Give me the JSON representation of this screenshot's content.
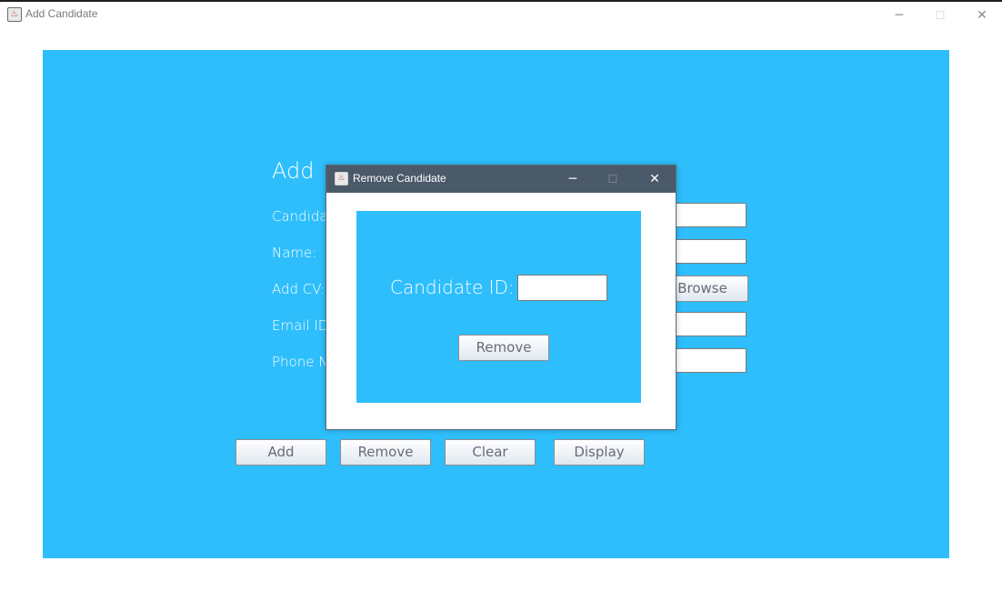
{
  "window": {
    "title": "Add Candidate",
    "controls": {
      "minimize": "─",
      "maximize": "☐",
      "close": "✕"
    }
  },
  "form": {
    "heading": "Add",
    "labels": [
      "Candida",
      "Name:",
      "Add CV:",
      "Email ID",
      "Phone N"
    ],
    "browse_button": "Browse",
    "buttons": {
      "add": "Add",
      "remove": "Remove",
      "clear": "Clear",
      "display": "Display"
    }
  },
  "dialog": {
    "title": "Remove Candidate",
    "controls": {
      "minimize": "─",
      "maximize": "☐",
      "close": "✕"
    },
    "candidate_id_label": "Candidate ID:",
    "candidate_id_value": "",
    "remove_button": "Remove"
  },
  "colors": {
    "panel_background": "#2ebefc",
    "dialog_titlebar": "#4a5a69"
  }
}
